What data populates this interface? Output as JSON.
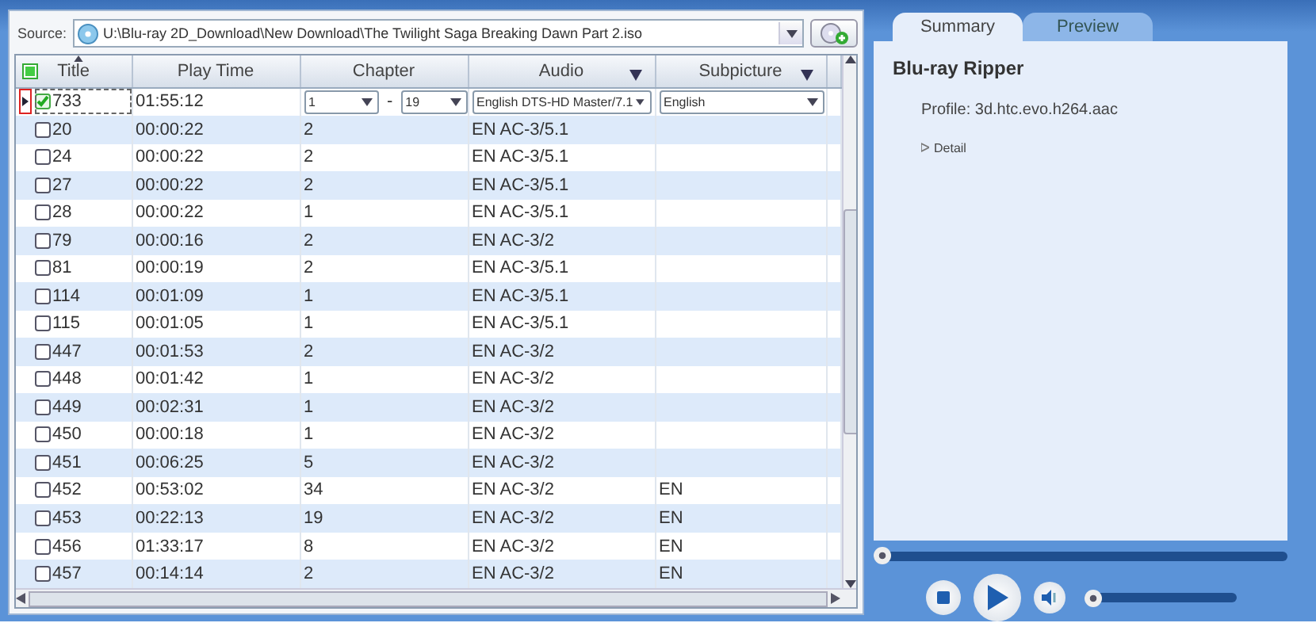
{
  "source": {
    "label": "Source:",
    "path": "U:\\Blu-ray 2D_Download\\New Download\\The Twilight Saga Breaking Dawn Part 2.iso"
  },
  "table": {
    "all_checked": true,
    "columns": [
      {
        "label": "Title",
        "sorted": true,
        "filter": false
      },
      {
        "label": "Play Time",
        "sorted": false,
        "filter": false
      },
      {
        "label": "Chapter",
        "sorted": false,
        "filter": false
      },
      {
        "label": "Audio",
        "sorted": false,
        "filter": true
      },
      {
        "label": "Subpicture",
        "sorted": false,
        "filter": true
      }
    ],
    "rows": [
      {
        "kind": "editable",
        "title": "733",
        "checked": true,
        "selected": true,
        "play_time": "01:55:12",
        "chapter_start": "1",
        "chapter_sep": "-",
        "chapter_end": "19",
        "audio": "English DTS-HD Master/7.1",
        "subpicture": "English"
      },
      {
        "kind": "plain",
        "title": "20",
        "checked": false,
        "selected": false,
        "play_time": "00:00:22",
        "chapter": "2",
        "audio": "EN AC-3/5.1"
      },
      {
        "kind": "plain",
        "title": "24",
        "checked": false,
        "selected": false,
        "play_time": "00:00:22",
        "chapter": "2",
        "audio": "EN AC-3/5.1"
      },
      {
        "kind": "plain",
        "title": "27",
        "checked": false,
        "selected": false,
        "play_time": "00:00:22",
        "chapter": "2",
        "audio": "EN AC-3/5.1"
      },
      {
        "kind": "plain",
        "title": "28",
        "checked": false,
        "selected": false,
        "play_time": "00:00:22",
        "chapter": "1",
        "audio": "EN AC-3/5.1"
      },
      {
        "kind": "plain",
        "title": "79",
        "checked": false,
        "selected": false,
        "play_time": "00:00:16",
        "chapter": "2",
        "audio": "EN AC-3/2"
      },
      {
        "kind": "plain",
        "title": "81",
        "checked": false,
        "selected": false,
        "play_time": "00:00:19",
        "chapter": "2",
        "audio": "EN AC-3/5.1"
      },
      {
        "kind": "plain",
        "title": "114",
        "checked": false,
        "selected": false,
        "play_time": "00:01:09",
        "chapter": "1",
        "audio": "EN AC-3/5.1"
      },
      {
        "kind": "plain",
        "title": "115",
        "checked": false,
        "selected": false,
        "play_time": "00:01:05",
        "chapter": "1",
        "audio": "EN AC-3/5.1"
      },
      {
        "kind": "plain",
        "title": "447",
        "checked": false,
        "selected": false,
        "play_time": "00:01:53",
        "chapter": "2",
        "audio": "EN AC-3/2"
      },
      {
        "kind": "plain",
        "title": "448",
        "checked": false,
        "selected": false,
        "play_time": "00:01:42",
        "chapter": "1",
        "audio": "EN AC-3/2"
      },
      {
        "kind": "plain",
        "title": "449",
        "checked": false,
        "selected": false,
        "play_time": "00:02:31",
        "chapter": "1",
        "audio": "EN AC-3/2"
      },
      {
        "kind": "plain",
        "title": "450",
        "checked": false,
        "selected": false,
        "play_time": "00:00:18",
        "chapter": "1",
        "audio": "EN AC-3/2"
      },
      {
        "kind": "plain",
        "title": "451",
        "checked": false,
        "selected": false,
        "play_time": "00:06:25",
        "chapter": "5",
        "audio": "EN AC-3/2"
      },
      {
        "kind": "plain",
        "title": "452",
        "checked": false,
        "selected": false,
        "play_time": "00:53:02",
        "chapter": "34",
        "audio": "EN AC-3/2",
        "subpicture": "EN"
      },
      {
        "kind": "plain",
        "title": "453",
        "checked": false,
        "selected": false,
        "play_time": "00:22:13",
        "chapter": "19",
        "audio": "EN AC-3/2",
        "subpicture": "EN"
      },
      {
        "kind": "plain",
        "title": "456",
        "checked": false,
        "selected": false,
        "play_time": "01:33:17",
        "chapter": "8",
        "audio": "EN AC-3/2",
        "subpicture": "EN"
      },
      {
        "kind": "plain",
        "title": "457",
        "checked": false,
        "selected": false,
        "play_time": "00:14:14",
        "chapter": "2",
        "audio": "EN AC-3/2",
        "subpicture": "EN"
      }
    ]
  },
  "tabs": [
    {
      "label": "Summary",
      "selected": true
    },
    {
      "label": "Preview",
      "selected": false
    }
  ],
  "summary": {
    "title": "Blu-ray Ripper",
    "profile": "Profile: 3d.htc.evo.h264.aac",
    "detail": "Detail",
    "detail_expanded": false
  },
  "player": {
    "seek": {
      "level": 0
    },
    "volume": {
      "level": 0
    }
  }
}
